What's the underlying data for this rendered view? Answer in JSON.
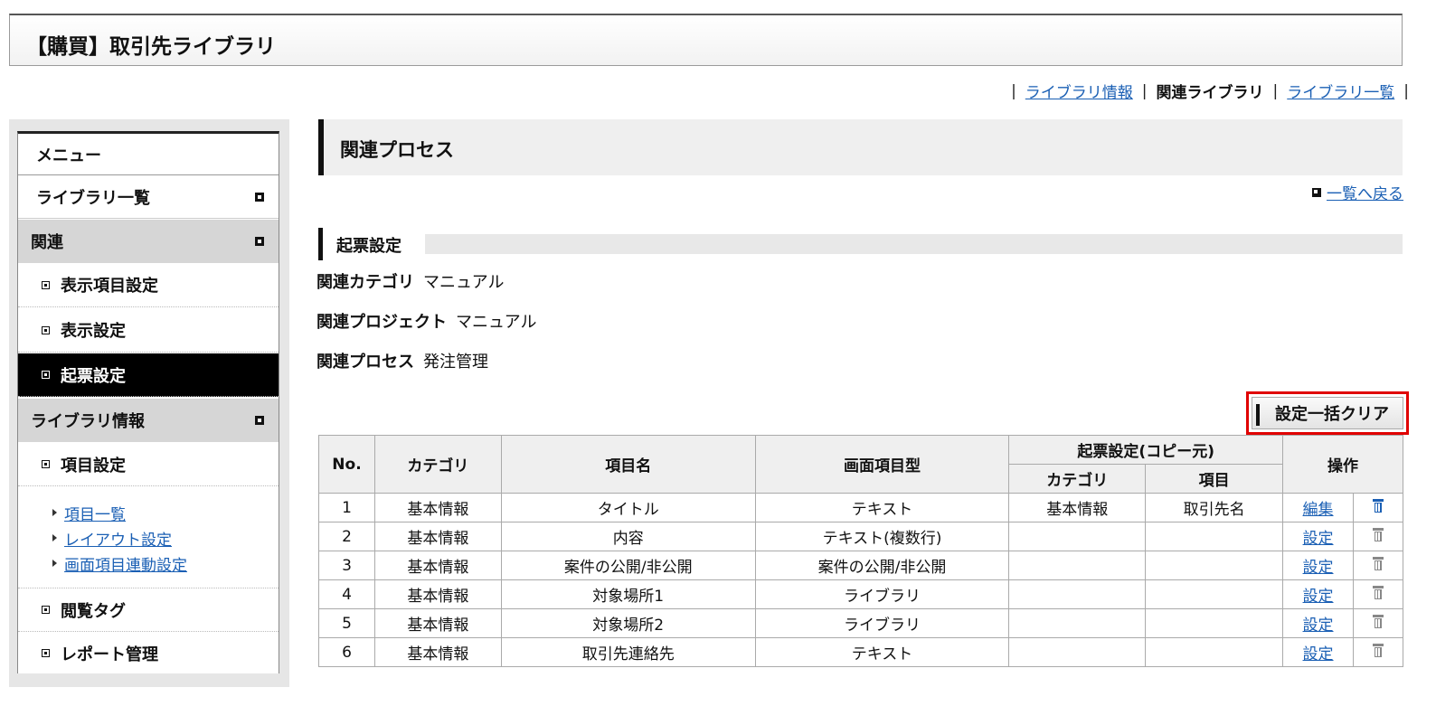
{
  "title": "【購買】取引先ライブラリ",
  "top_nav": {
    "items": [
      {
        "label": "ライブラリ情報",
        "current": false
      },
      {
        "label": "関連ライブラリ",
        "current": true
      },
      {
        "label": "ライブラリ一覧",
        "current": false
      }
    ]
  },
  "sidebar": {
    "header": "メニュー",
    "library_list": "ライブラリ一覧",
    "related": "関連",
    "related_items": [
      "表示項目設定",
      "表示設定",
      "起票設定"
    ],
    "library_info": "ライブラリ情報",
    "item_settings": "項目設定",
    "item_links": [
      "項目一覧",
      "レイアウト設定",
      "画面項目連動設定"
    ],
    "view_tags": "閲覧タグ",
    "report_mgmt": "レポート管理"
  },
  "main": {
    "section_title": "関連プロセス",
    "back_link": "一覧へ戻る",
    "sub_title": "起票設定",
    "info": [
      {
        "label": "関連カテゴリ",
        "value": "マニュアル"
      },
      {
        "label": "関連プロジェクト",
        "value": "マニュアル"
      },
      {
        "label": "関連プロセス",
        "value": "発注管理"
      }
    ],
    "clear_button": "設定一括クリア"
  },
  "table": {
    "headers": {
      "no": "No.",
      "category": "カテゴリ",
      "item_name": "項目名",
      "screen_type": "画面項目型",
      "copy_source": "起票設定(コピー元)",
      "copy_category": "カテゴリ",
      "copy_item": "項目",
      "ops": "操作"
    },
    "rows": [
      {
        "no": "1",
        "category": "基本情報",
        "item": "タイトル",
        "type": "テキスト",
        "src_cat": "基本情報",
        "src_item": "取引先名",
        "action": "編集",
        "trash_active": true
      },
      {
        "no": "2",
        "category": "基本情報",
        "item": "内容",
        "type": "テキスト(複数行)",
        "src_cat": "",
        "src_item": "",
        "action": "設定",
        "trash_active": false
      },
      {
        "no": "3",
        "category": "基本情報",
        "item": "案件の公開/非公開",
        "type": "案件の公開/非公開",
        "src_cat": "",
        "src_item": "",
        "action": "設定",
        "trash_active": false
      },
      {
        "no": "4",
        "category": "基本情報",
        "item": "対象場所1",
        "type": "ライブラリ",
        "src_cat": "",
        "src_item": "",
        "action": "設定",
        "trash_active": false
      },
      {
        "no": "5",
        "category": "基本情報",
        "item": "対象場所2",
        "type": "ライブラリ",
        "src_cat": "",
        "src_item": "",
        "action": "設定",
        "trash_active": false
      },
      {
        "no": "6",
        "category": "基本情報",
        "item": "取引先連絡先",
        "type": "テキスト",
        "src_cat": "",
        "src_item": "",
        "action": "設定",
        "trash_active": false
      }
    ]
  }
}
